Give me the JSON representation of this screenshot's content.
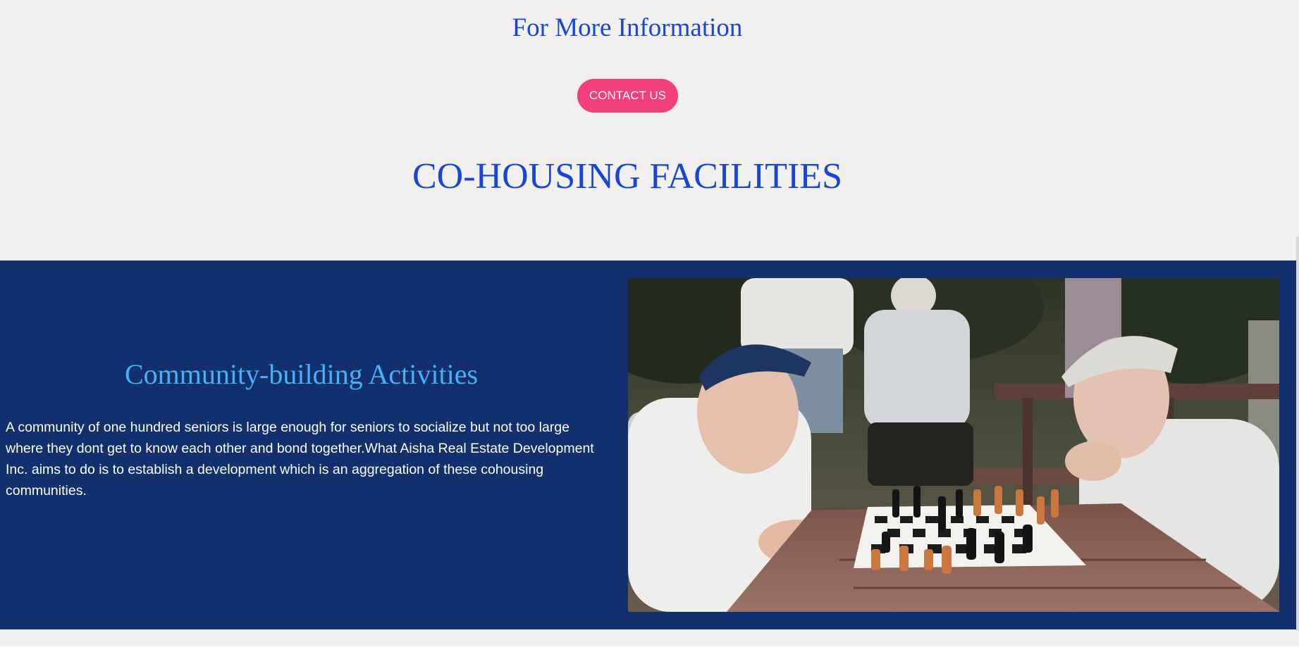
{
  "info": {
    "title": "For More Information",
    "contact_label": "CONTACT US"
  },
  "facilities": {
    "title": "CO-HOUSING FACILITIES"
  },
  "activity": {
    "title": "Community-building Activities",
    "description": "A community of one hundred seniors is large enough for seniors to socialize but not too large where they dont get to know each other and bond together.What Aisha Real Estate Development Inc. aims to do is to establish a development which is an aggregation of these cohousing communities."
  },
  "colors": {
    "page_background": "#f1f0ee",
    "heading_blue": "#1846d4",
    "button_pink": "#f23e7b",
    "band_navy": "#122f6e",
    "subheading_cyan": "#46b2f3"
  },
  "icons": {
    "photo": "seniors-playing-chess-photo"
  }
}
